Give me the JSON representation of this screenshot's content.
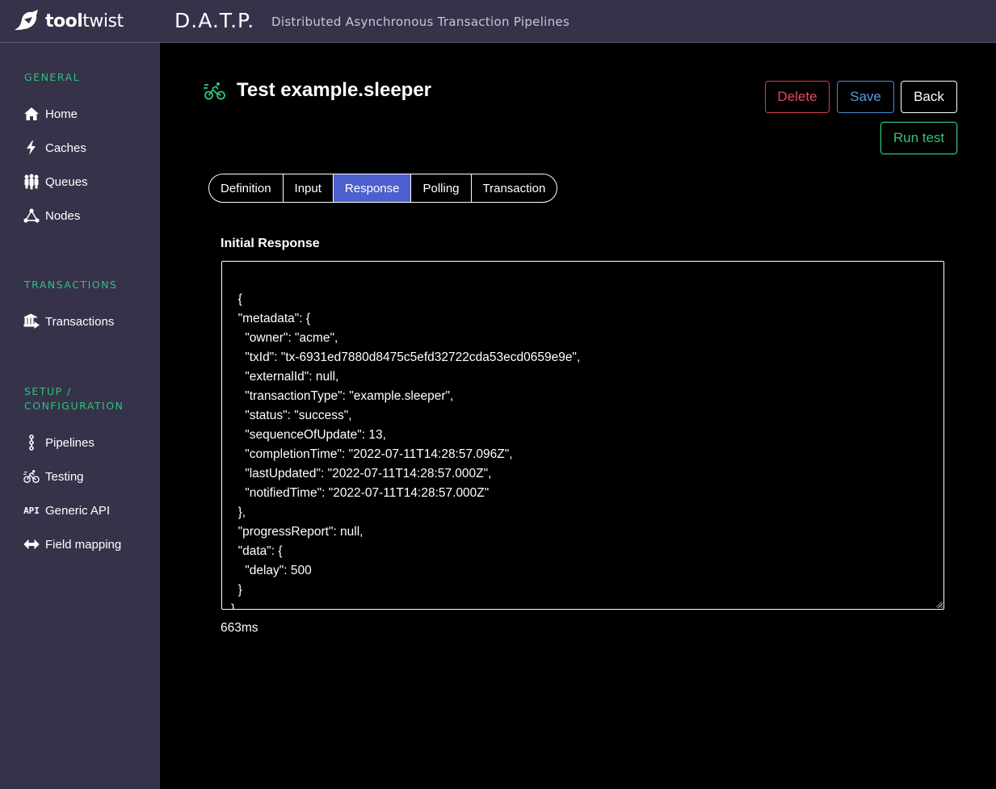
{
  "brand": {
    "logo_bold": "tool",
    "logo_light": "twist"
  },
  "header": {
    "title": "D.A.T.P.",
    "subtitle": "Distributed Asynchronous Transaction Pipelines"
  },
  "sidebar": {
    "sections": [
      {
        "title": "GENERAL",
        "items": [
          {
            "label": "Home",
            "icon": "home-icon"
          },
          {
            "label": "Caches",
            "icon": "lightning-icon"
          },
          {
            "label": "Queues",
            "icon": "people-queue-icon"
          },
          {
            "label": "Nodes",
            "icon": "nodes-icon"
          }
        ]
      },
      {
        "title": "TRANSACTIONS",
        "items": [
          {
            "label": "Transactions",
            "icon": "bank-icon"
          }
        ]
      },
      {
        "title_line1": "SETUP /",
        "title_line2": "CONFIGURATION",
        "items": [
          {
            "label": "Pipelines",
            "icon": "pipeline-icon"
          },
          {
            "label": "Testing",
            "icon": "cyclist-icon"
          },
          {
            "label": "Generic API",
            "icon": "api-icon"
          },
          {
            "label": "Field mapping",
            "icon": "arrows-left-right-icon"
          }
        ]
      }
    ]
  },
  "page": {
    "title": "Test example.sleeper",
    "title_icon": "cyclist-icon",
    "buttons": {
      "delete": "Delete",
      "save": "Save",
      "back": "Back",
      "run": "Run test"
    },
    "tabs": [
      {
        "label": "Definition",
        "active": false
      },
      {
        "label": "Input",
        "active": false
      },
      {
        "label": "Response",
        "active": true
      },
      {
        "label": "Polling",
        "active": false
      },
      {
        "label": "Transaction",
        "active": false
      }
    ],
    "response_label": "Initial Response",
    "response_text": "{\n  \"metadata\": {\n    \"owner\": \"acme\",\n    \"txId\": \"tx-6931ed7880d8475c5efd32722cda53ecd0659e9e\",\n    \"externalId\": null,\n    \"transactionType\": \"example.sleeper\",\n    \"status\": \"success\",\n    \"sequenceOfUpdate\": 13,\n    \"completionTime\": \"2022-07-11T14:28:57.096Z\",\n    \"lastUpdated\": \"2022-07-11T14:28:57.000Z\",\n    \"notifiedTime\": \"2022-07-11T14:28:57.000Z\"\n  },\n  \"progressReport\": null,\n  \"data\": {\n    \"delay\": 500\n  }\n}",
    "timing": "663ms"
  },
  "colors": {
    "accent_green": "#2fc27a",
    "sidebar_bg": "#36324a",
    "tab_active": "#4e5fcf",
    "delete_red": "#e8495f",
    "save_blue": "#5b9ae0"
  }
}
